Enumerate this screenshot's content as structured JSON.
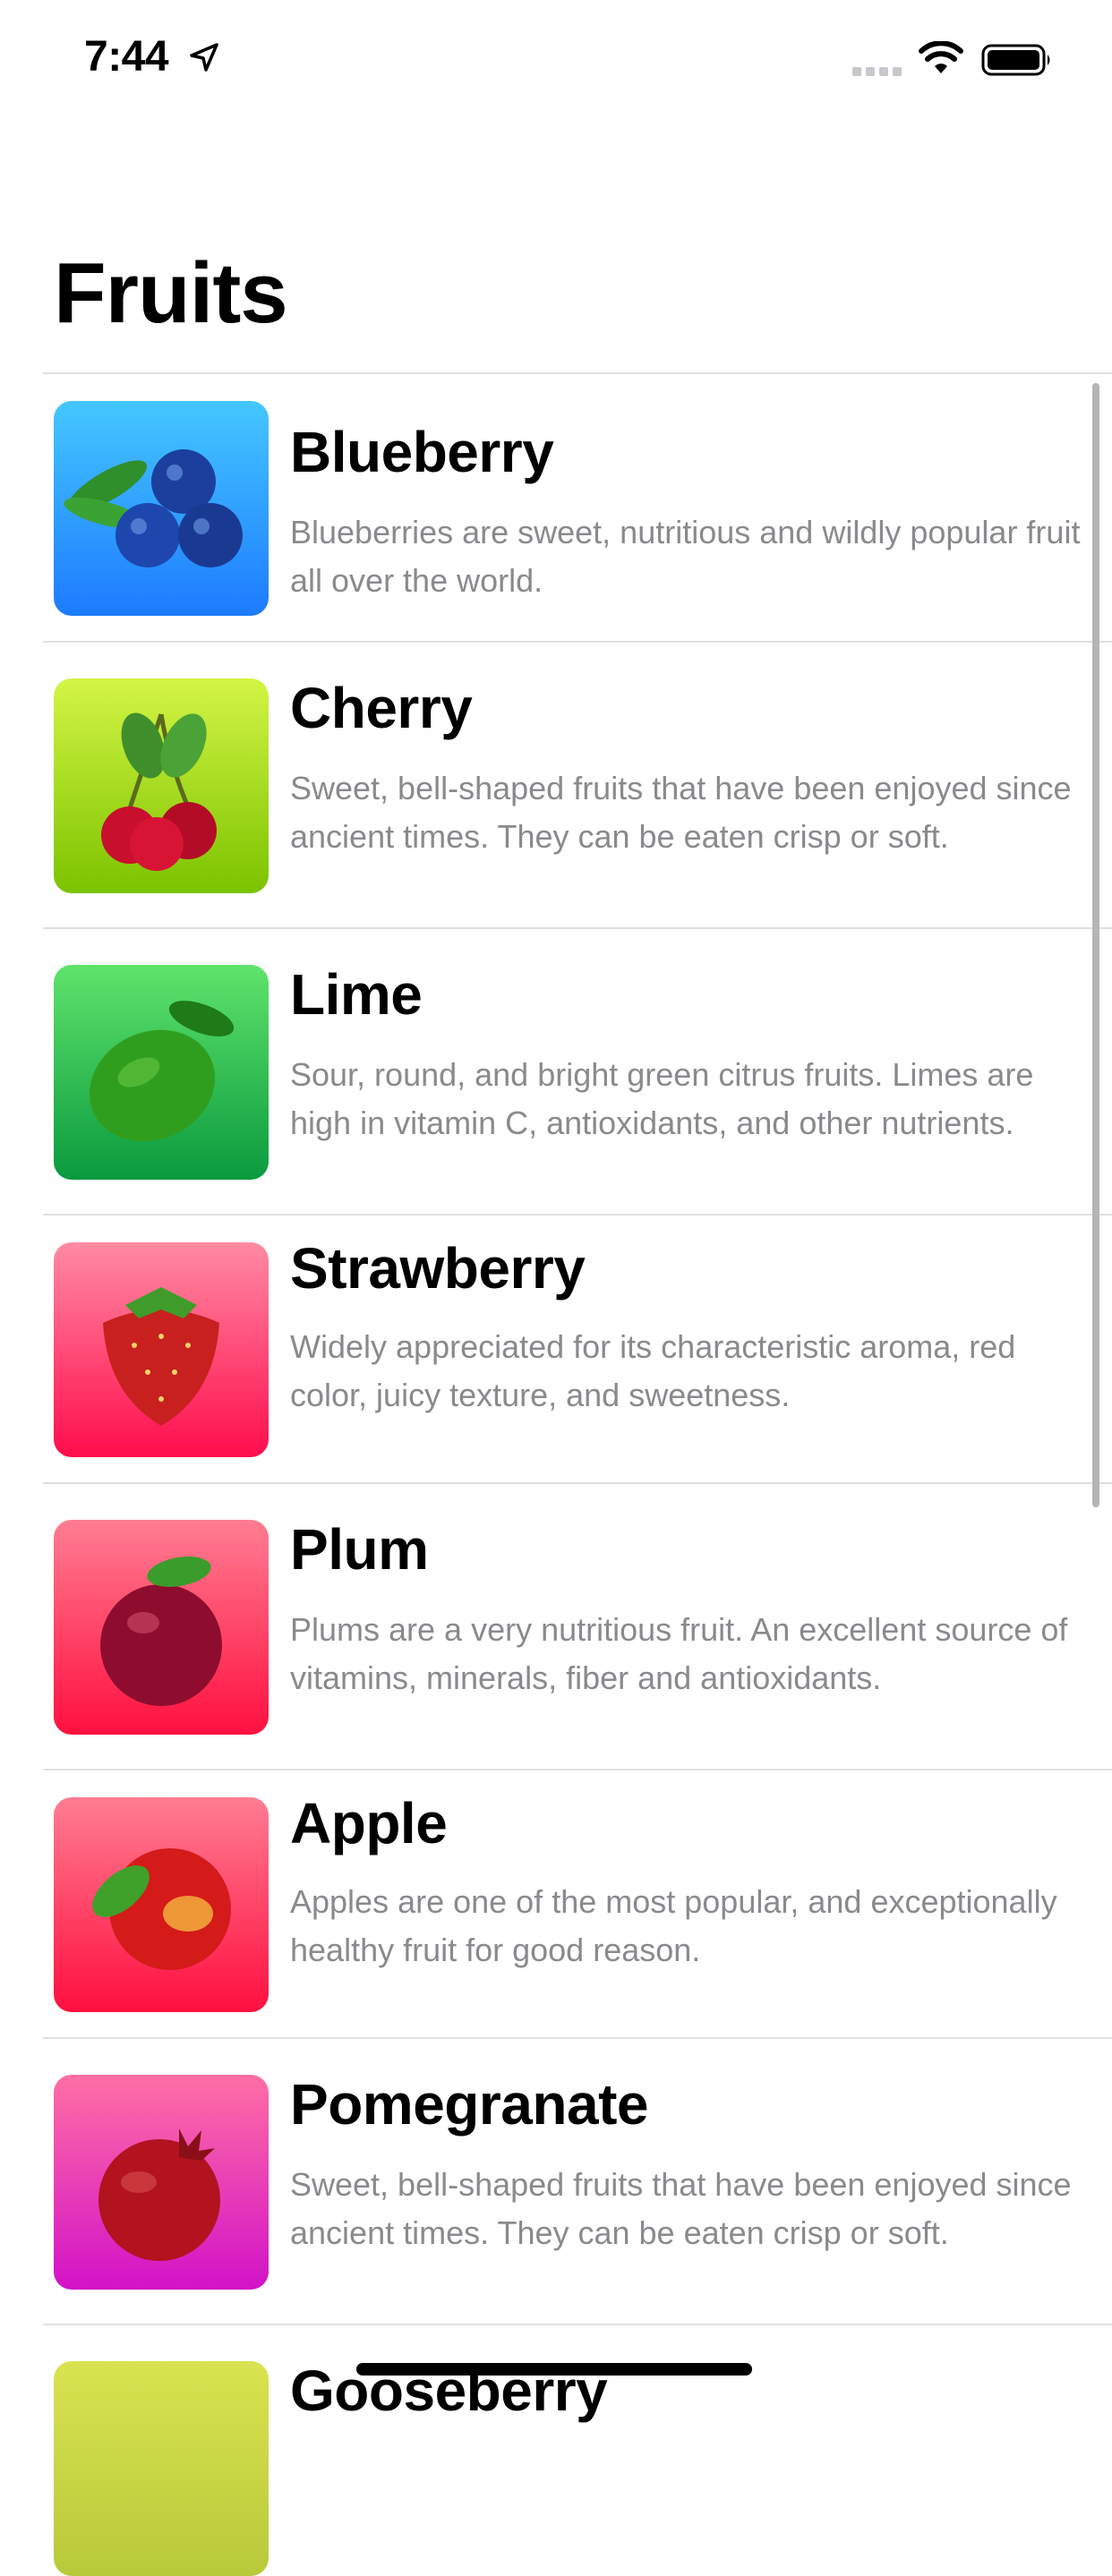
{
  "status_bar": {
    "time": "7:44",
    "icons": [
      "location-arrow-icon",
      "cellular-signal-icon",
      "wifi-icon",
      "battery-icon"
    ]
  },
  "navigation": {
    "title": "Fruits"
  },
  "fruits": [
    {
      "title": "Blueberry",
      "description": "Blueberries are sweet, nutritious and wildly popular fruit all over the world.",
      "gradient": [
        "#45c7ff",
        "#1d7bff"
      ],
      "icon": "blueberry-icon"
    },
    {
      "title": "Cherry",
      "description": "Sweet, bell-shaped fruits that have been enjoyed since ancient times. They can be eaten crisp or soft.",
      "gradient": [
        "#d4f545",
        "#7bc300"
      ],
      "icon": "cherry-icon"
    },
    {
      "title": "Lime",
      "description": "Sour, round, and bright green citrus fruits. Limes are high in vitamin C, antioxidants, and other nutrients.",
      "gradient": [
        "#5fe36b",
        "#0a9a3e"
      ],
      "icon": "lime-icon"
    },
    {
      "title": "Strawberry",
      "description": "Widely appreciated for its characteristic aroma, red color, juicy texture, and sweetness.",
      "gradient": [
        "#ff8ba3",
        "#ff0d4d"
      ],
      "icon": "strawberry-icon"
    },
    {
      "title": "Plum",
      "description": "Plums are a very nutritious fruit. An excellent source of vitamins, minerals, fiber and antioxidants.",
      "gradient": [
        "#ff7d92",
        "#ff1040"
      ],
      "icon": "plum-icon"
    },
    {
      "title": "Apple",
      "description": "Apples are one of the most popular, and exceptionally healthy fruit for good reason.",
      "gradient": [
        "#ff7d92",
        "#ff1040"
      ],
      "icon": "apple-icon"
    },
    {
      "title": "Pomegranate",
      "description": "Sweet, bell-shaped fruits that have been enjoyed since ancient times. They can be eaten crisp or soft.",
      "gradient": [
        "#ff6fa4",
        "#d312c8"
      ],
      "icon": "pomegranate-icon"
    },
    {
      "title": "Gooseberry",
      "description": "",
      "gradient": [
        "#d9e350",
        "#b8c93a"
      ],
      "icon": "gooseberry-icon"
    }
  ]
}
